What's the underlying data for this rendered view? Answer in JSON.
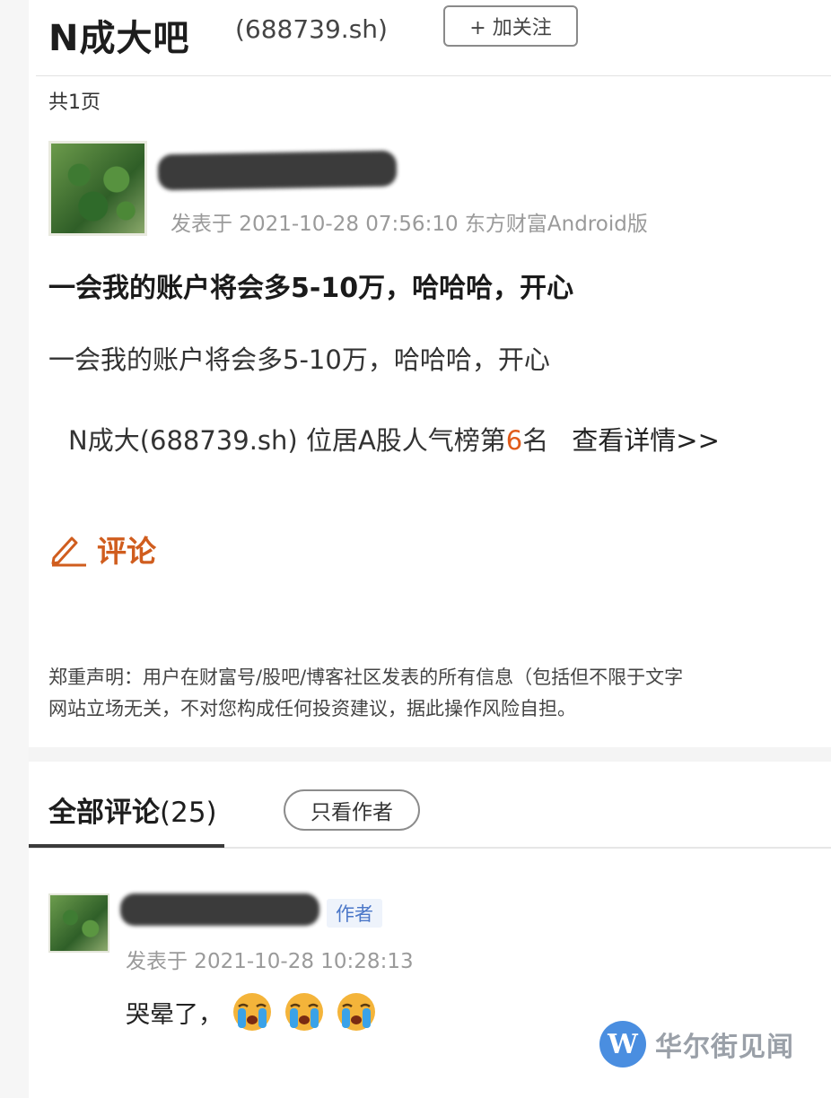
{
  "header": {
    "bar_title": "N成大吧",
    "stock_code": "(688739.sh)",
    "follow_label": "+ 加关注",
    "page_count": "共1页"
  },
  "post": {
    "meta": "发表于 2021-10-28 07:56:10 东方财富Android版",
    "title": "一会我的账户将会多5-10万，哈哈哈，开心",
    "body": "一会我的账户将会多5-10万，哈哈哈，开心",
    "rank_prefix": "N成大(688739.sh) 位居A股人气榜第",
    "rank_number": "6",
    "rank_suffix": "名",
    "rank_link": "查看详情>>"
  },
  "comment_action": {
    "label": "评论",
    "icon": "pen-icon"
  },
  "disclaimer": {
    "line1": "郑重声明：用户在财富号/股吧/博客社区发表的所有信息（包括但不限于文字",
    "line2": "网站立场无关，不对您构成任何投资建议，据此操作风险自担。"
  },
  "comments_section": {
    "title": "全部评论",
    "count": "(25)",
    "only_author_label": "只看作者"
  },
  "comments": [
    {
      "author_tag": "作者",
      "meta": "发表于 2021-10-28 10:28:13",
      "text": "哭晕了，",
      "emojis": [
        "crying-emoji",
        "crying-emoji",
        "crying-emoji"
      ]
    }
  ],
  "watermark": {
    "logo_letter": "W",
    "text": "华尔街见闻"
  },
  "colors": {
    "accent_orange": "#d05d1e",
    "rank_number": "#e05b1a",
    "author_tag": "#4b77c8",
    "watermark_blue": "#4a8ee0"
  }
}
